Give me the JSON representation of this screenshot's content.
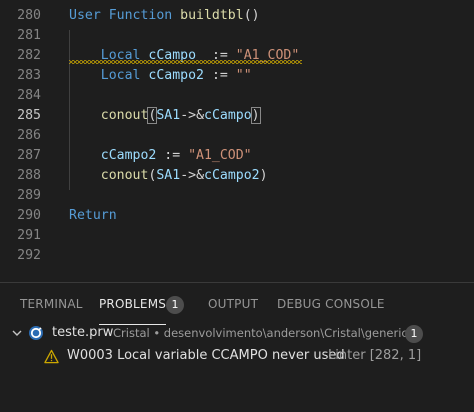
{
  "editor": {
    "lines": [
      {
        "num": "280",
        "tokens": [
          {
            "t": "User Function ",
            "c": "kw"
          },
          {
            "t": "buildtbl",
            "c": "fn"
          },
          {
            "t": "()",
            "c": "op"
          }
        ]
      },
      {
        "num": "281",
        "tokens": []
      },
      {
        "num": "282",
        "tokens": [
          {
            "t": "    Local ",
            "c": "kw"
          },
          {
            "t": "cCampo  ",
            "c": "var"
          },
          {
            "t": ":= ",
            "c": "op"
          },
          {
            "t": "\"A1_COD\"",
            "c": "str"
          }
        ]
      },
      {
        "num": "283",
        "tokens": [
          {
            "t": "    Local ",
            "c": "kw"
          },
          {
            "t": "cCampo2 ",
            "c": "var"
          },
          {
            "t": ":= ",
            "c": "op"
          },
          {
            "t": "\"\"",
            "c": "str"
          }
        ]
      },
      {
        "num": "284",
        "tokens": []
      },
      {
        "num": "285",
        "active": true,
        "tokens": [
          {
            "t": "    conout",
            "c": "fn"
          },
          {
            "t": "(",
            "c": "op",
            "match": true
          },
          {
            "t": "SA1",
            "c": "var"
          },
          {
            "t": "->&",
            "c": "op"
          },
          {
            "t": "cCampo",
            "c": "var"
          },
          {
            "t": ")",
            "c": "op",
            "match": true
          }
        ]
      },
      {
        "num": "286",
        "tokens": []
      },
      {
        "num": "287",
        "tokens": [
          {
            "t": "    cCampo2 ",
            "c": "var"
          },
          {
            "t": ":= ",
            "c": "op"
          },
          {
            "t": "\"A1_COD\"",
            "c": "str"
          }
        ]
      },
      {
        "num": "288",
        "tokens": [
          {
            "t": "    conout",
            "c": "fn"
          },
          {
            "t": "(",
            "c": "op"
          },
          {
            "t": "SA1",
            "c": "var"
          },
          {
            "t": "->&",
            "c": "op"
          },
          {
            "t": "cCampo2",
            "c": "var"
          },
          {
            "t": ")",
            "c": "op"
          }
        ]
      },
      {
        "num": "289",
        "tokens": []
      },
      {
        "num": "290",
        "tokens": [
          {
            "t": "Return",
            "c": "kw"
          }
        ]
      },
      {
        "num": "291",
        "tokens": []
      },
      {
        "num": "292",
        "tokens": []
      }
    ]
  },
  "panel": {
    "tabs": {
      "terminal": "TERMINAL",
      "problems": "PROBLEMS",
      "problems_count": "1",
      "output": "OUTPUT",
      "debug_console": "DEBUG CONSOLE"
    },
    "problems": {
      "file": {
        "name": "teste.prw",
        "path": "Cristal • desenvolvimento\\anderson\\Cristal\\generico",
        "count": "1",
        "icon": "file-type-icon"
      },
      "items": [
        {
          "severity": "warning",
          "message": "W0003 Local variable CCAMPO never used",
          "source": "Linter",
          "position": "[282, 1]"
        }
      ]
    }
  },
  "colors": {
    "background": "#1e1e1e",
    "keyword": "#569cd6",
    "function": "#dcdcaa",
    "variable": "#9cdcfe",
    "string": "#ce9178",
    "warning": "#cca700"
  }
}
